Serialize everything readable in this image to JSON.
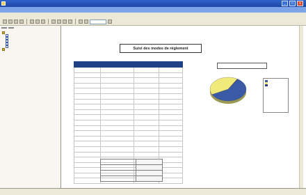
{
  "window": {
    "title": "",
    "subtitle": "",
    "buttons": {
      "minimize": "_",
      "maximize": "□",
      "close": "x"
    }
  },
  "menu": [
    "",
    "",
    "",
    "",
    "",
    "",
    "",
    "",
    ""
  ],
  "toolbar": {
    "zoom_value": ""
  },
  "left_panel": {
    "tabs": [
      "",
      ""
    ],
    "tree": [
      {
        "label": ""
      },
      {
        "label": ""
      },
      {
        "label": ""
      },
      {
        "label": ""
      },
      {
        "label": ""
      },
      {
        "label": ""
      },
      {
        "label": ""
      }
    ]
  },
  "report": {
    "small_label": "",
    "title": "Suivi des modes de règlement",
    "table": {
      "headers": [
        "",
        "",
        "",
        ""
      ],
      "rows": [
        [
          "",
          "",
          "",
          ""
        ],
        [
          "",
          "",
          "",
          ""
        ],
        [
          "",
          "",
          "",
          ""
        ],
        [
          "",
          "",
          "",
          ""
        ],
        [
          "",
          "",
          "",
          ""
        ],
        [
          "",
          "",
          "",
          ""
        ],
        [
          "",
          "",
          "",
          ""
        ],
        [
          "",
          "",
          "",
          ""
        ],
        [
          "",
          "",
          "",
          ""
        ],
        [
          "",
          "",
          "",
          ""
        ],
        [
          "",
          "",
          "",
          ""
        ],
        [
          "",
          "",
          "",
          ""
        ],
        [
          "",
          "",
          "",
          ""
        ],
        [
          "",
          "",
          "",
          ""
        ],
        [
          "",
          "",
          "",
          ""
        ],
        [
          "",
          "",
          "",
          ""
        ],
        [
          "",
          "",
          "",
          ""
        ],
        [
          "",
          "",
          "",
          ""
        ],
        [
          "",
          "",
          "",
          ""
        ],
        [
          "",
          "",
          "",
          ""
        ],
        [
          "",
          "",
          "",
          ""
        ],
        [
          "",
          "",
          "",
          ""
        ]
      ]
    },
    "totals": [
      {
        "label": "",
        "value": ""
      },
      {
        "label": "",
        "value": ""
      },
      {
        "label": "",
        "value": ""
      },
      {
        "label": "",
        "value": ""
      }
    ]
  },
  "chart_data": {
    "type": "pie",
    "title": "",
    "slices": [
      {
        "label": "",
        "value": 58,
        "color": "#3b5aa6"
      },
      {
        "label": "",
        "value": 41,
        "color": "#f0ea7a"
      },
      {
        "label": "",
        "value": 1,
        "color": "#2d3f8a"
      }
    ],
    "data_labels": [
      "",
      "",
      ""
    ],
    "legend": [
      "",
      "",
      ""
    ],
    "legend_position": "right"
  },
  "colors": {
    "titlebar": "#1d47a6",
    "table_header": "#1f3f86",
    "pie_blue": "#3b5aa6",
    "pie_yellow": "#f0ea7a"
  }
}
